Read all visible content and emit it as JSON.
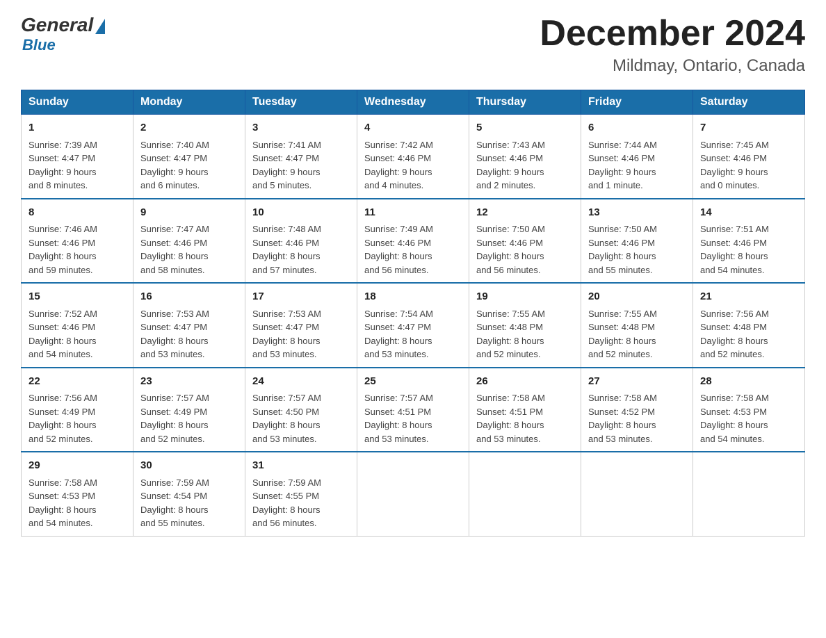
{
  "header": {
    "title": "December 2024",
    "location": "Mildmay, Ontario, Canada",
    "logo_general": "General",
    "logo_blue": "Blue"
  },
  "weekdays": [
    "Sunday",
    "Monday",
    "Tuesday",
    "Wednesday",
    "Thursday",
    "Friday",
    "Saturday"
  ],
  "weeks": [
    [
      {
        "day": "1",
        "sunrise": "7:39 AM",
        "sunset": "4:47 PM",
        "daylight": "9 hours and 8 minutes."
      },
      {
        "day": "2",
        "sunrise": "7:40 AM",
        "sunset": "4:47 PM",
        "daylight": "9 hours and 6 minutes."
      },
      {
        "day": "3",
        "sunrise": "7:41 AM",
        "sunset": "4:47 PM",
        "daylight": "9 hours and 5 minutes."
      },
      {
        "day": "4",
        "sunrise": "7:42 AM",
        "sunset": "4:46 PM",
        "daylight": "9 hours and 4 minutes."
      },
      {
        "day": "5",
        "sunrise": "7:43 AM",
        "sunset": "4:46 PM",
        "daylight": "9 hours and 2 minutes."
      },
      {
        "day": "6",
        "sunrise": "7:44 AM",
        "sunset": "4:46 PM",
        "daylight": "9 hours and 1 minute."
      },
      {
        "day": "7",
        "sunrise": "7:45 AM",
        "sunset": "4:46 PM",
        "daylight": "9 hours and 0 minutes."
      }
    ],
    [
      {
        "day": "8",
        "sunrise": "7:46 AM",
        "sunset": "4:46 PM",
        "daylight": "8 hours and 59 minutes."
      },
      {
        "day": "9",
        "sunrise": "7:47 AM",
        "sunset": "4:46 PM",
        "daylight": "8 hours and 58 minutes."
      },
      {
        "day": "10",
        "sunrise": "7:48 AM",
        "sunset": "4:46 PM",
        "daylight": "8 hours and 57 minutes."
      },
      {
        "day": "11",
        "sunrise": "7:49 AM",
        "sunset": "4:46 PM",
        "daylight": "8 hours and 56 minutes."
      },
      {
        "day": "12",
        "sunrise": "7:50 AM",
        "sunset": "4:46 PM",
        "daylight": "8 hours and 56 minutes."
      },
      {
        "day": "13",
        "sunrise": "7:50 AM",
        "sunset": "4:46 PM",
        "daylight": "8 hours and 55 minutes."
      },
      {
        "day": "14",
        "sunrise": "7:51 AM",
        "sunset": "4:46 PM",
        "daylight": "8 hours and 54 minutes."
      }
    ],
    [
      {
        "day": "15",
        "sunrise": "7:52 AM",
        "sunset": "4:46 PM",
        "daylight": "8 hours and 54 minutes."
      },
      {
        "day": "16",
        "sunrise": "7:53 AM",
        "sunset": "4:47 PM",
        "daylight": "8 hours and 53 minutes."
      },
      {
        "day": "17",
        "sunrise": "7:53 AM",
        "sunset": "4:47 PM",
        "daylight": "8 hours and 53 minutes."
      },
      {
        "day": "18",
        "sunrise": "7:54 AM",
        "sunset": "4:47 PM",
        "daylight": "8 hours and 53 minutes."
      },
      {
        "day": "19",
        "sunrise": "7:55 AM",
        "sunset": "4:48 PM",
        "daylight": "8 hours and 52 minutes."
      },
      {
        "day": "20",
        "sunrise": "7:55 AM",
        "sunset": "4:48 PM",
        "daylight": "8 hours and 52 minutes."
      },
      {
        "day": "21",
        "sunrise": "7:56 AM",
        "sunset": "4:48 PM",
        "daylight": "8 hours and 52 minutes."
      }
    ],
    [
      {
        "day": "22",
        "sunrise": "7:56 AM",
        "sunset": "4:49 PM",
        "daylight": "8 hours and 52 minutes."
      },
      {
        "day": "23",
        "sunrise": "7:57 AM",
        "sunset": "4:49 PM",
        "daylight": "8 hours and 52 minutes."
      },
      {
        "day": "24",
        "sunrise": "7:57 AM",
        "sunset": "4:50 PM",
        "daylight": "8 hours and 53 minutes."
      },
      {
        "day": "25",
        "sunrise": "7:57 AM",
        "sunset": "4:51 PM",
        "daylight": "8 hours and 53 minutes."
      },
      {
        "day": "26",
        "sunrise": "7:58 AM",
        "sunset": "4:51 PM",
        "daylight": "8 hours and 53 minutes."
      },
      {
        "day": "27",
        "sunrise": "7:58 AM",
        "sunset": "4:52 PM",
        "daylight": "8 hours and 53 minutes."
      },
      {
        "day": "28",
        "sunrise": "7:58 AM",
        "sunset": "4:53 PM",
        "daylight": "8 hours and 54 minutes."
      }
    ],
    [
      {
        "day": "29",
        "sunrise": "7:58 AM",
        "sunset": "4:53 PM",
        "daylight": "8 hours and 54 minutes."
      },
      {
        "day": "30",
        "sunrise": "7:59 AM",
        "sunset": "4:54 PM",
        "daylight": "8 hours and 55 minutes."
      },
      {
        "day": "31",
        "sunrise": "7:59 AM",
        "sunset": "4:55 PM",
        "daylight": "8 hours and 56 minutes."
      },
      null,
      null,
      null,
      null
    ]
  ],
  "labels": {
    "sunrise": "Sunrise:",
    "sunset": "Sunset:",
    "daylight": "Daylight:"
  }
}
